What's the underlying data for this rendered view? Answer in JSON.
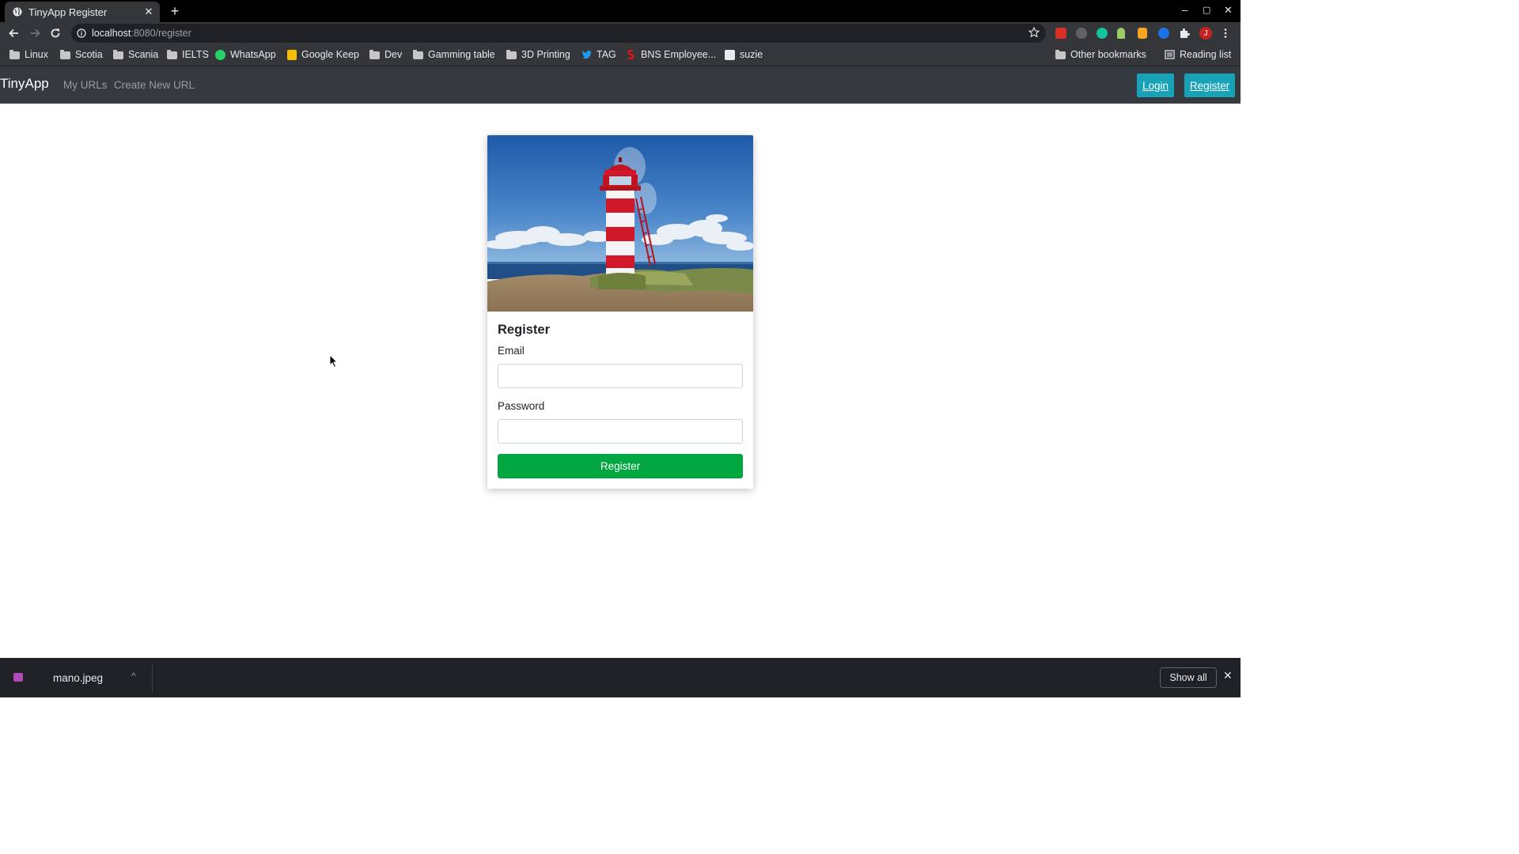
{
  "browser": {
    "tab_title": "TinyApp Register",
    "new_tab_symbol": "+",
    "close_symbol": "✕",
    "url_host": "localhost",
    "url_path": ":8080/register",
    "window_controls": [
      "–",
      "▢",
      "✕"
    ],
    "bookmarks": [
      {
        "label": "Linux",
        "icon": "folder-icon"
      },
      {
        "label": "Scotia",
        "icon": "folder-icon"
      },
      {
        "label": "Scania",
        "icon": "folder-icon"
      },
      {
        "label": "IELTS",
        "icon": "folder-icon"
      },
      {
        "label": "WhatsApp",
        "icon": "whatsapp-icon"
      },
      {
        "label": "Google Keep",
        "icon": "google-keep-icon"
      },
      {
        "label": "Dev",
        "icon": "folder-icon"
      },
      {
        "label": "Gamming table",
        "icon": "folder-icon"
      },
      {
        "label": "3D Printing",
        "icon": "folder-icon"
      },
      {
        "label": "TAG",
        "icon": "twitter-icon"
      },
      {
        "label": "BNS Employee...",
        "icon": "scotiabank-icon"
      },
      {
        "label": "suzie",
        "icon": "amazon-icon"
      }
    ],
    "other_bookmarks": "Other bookmarks",
    "reading_list": "Reading list",
    "profile_initial": "J"
  },
  "app_nav": {
    "brand": "TinyApp",
    "links": [
      "My URLs",
      "Create New URL"
    ],
    "login": "Login",
    "register": "Register",
    "accent_color": "#17a2b8",
    "background_color": "#343a40"
  },
  "form": {
    "title": "Register",
    "email_label": "Email",
    "email_value": "",
    "password_label": "Password",
    "password_value": "",
    "submit_label": "Register",
    "submit_color": "#00a63f",
    "image": "lighthouse-photo"
  },
  "downloads": {
    "file_name": "mano.jpeg",
    "chevron": "^",
    "show_all": "Show all",
    "close_symbol": "✕"
  }
}
